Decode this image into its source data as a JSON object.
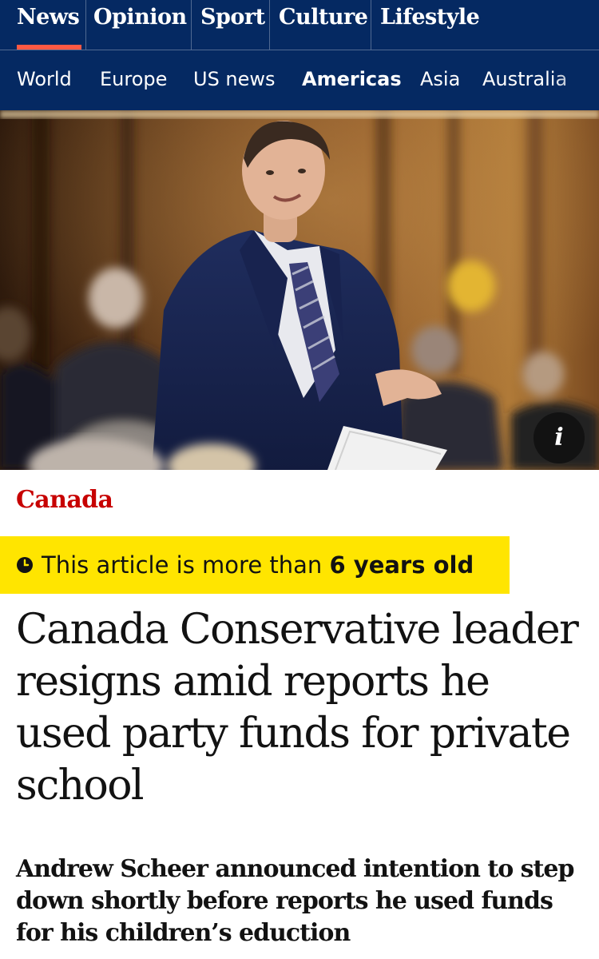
{
  "header": {
    "pillars": [
      {
        "label": "News",
        "active": true
      },
      {
        "label": "Opinion",
        "active": false
      },
      {
        "label": "Sport",
        "active": false
      },
      {
        "label": "Culture",
        "active": false
      },
      {
        "label": "Lifestyle",
        "active": false
      }
    ],
    "subnav": [
      {
        "label": "World",
        "active": false
      },
      {
        "label": "Europe",
        "active": false
      },
      {
        "label": "US news",
        "active": false
      },
      {
        "label": "Americas",
        "active": true
      },
      {
        "label": "Asia",
        "active": false
      },
      {
        "label": "Australia",
        "active": false
      }
    ]
  },
  "hero": {
    "info_label": "i",
    "icon": "info-icon"
  },
  "article": {
    "section": "Canada",
    "age_notice": {
      "icon": "clock-icon",
      "prefix": "This article is more than",
      "highlight": "6 years old"
    },
    "headline": "Canada Conservative leader resigns amid reports he used party funds for private school",
    "standfirst": "Andrew Scheer announced intention to step down shortly before reports he used funds for his children’s eduction"
  },
  "colors": {
    "brand_navy": "#052962",
    "news_accent": "#ff5943",
    "section_red": "#c70000",
    "age_yellow": "#ffe500"
  }
}
